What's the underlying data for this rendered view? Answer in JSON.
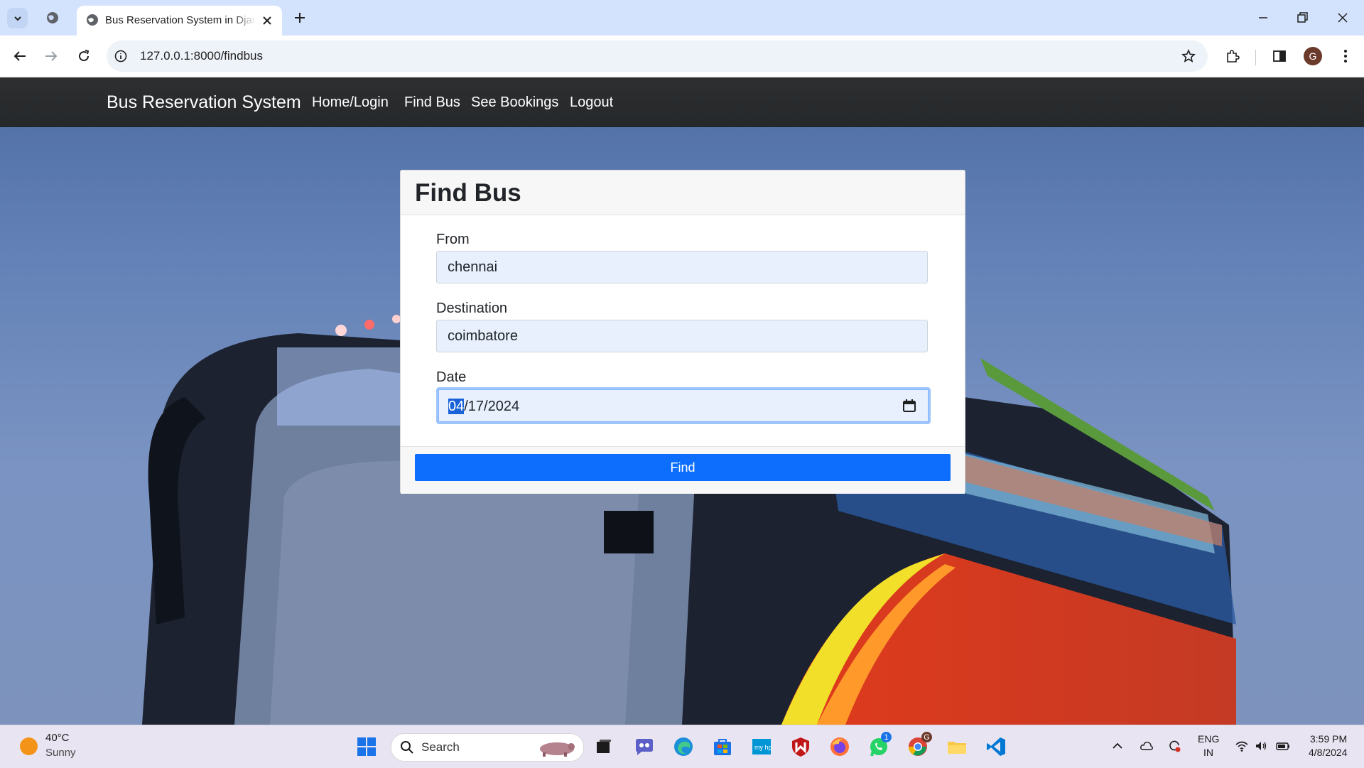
{
  "browser": {
    "tab_title": "Bus Reservation System in Django",
    "url": "127.0.0.1:8000/findbus",
    "profile_initial": "G"
  },
  "navbar": {
    "brand": "Bus Reservation System",
    "links": [
      "Home/Login",
      "Find Bus",
      "See Bookings",
      "Logout"
    ]
  },
  "form": {
    "title": "Find Bus",
    "from_label": "From",
    "from_value": "chennai",
    "destination_label": "Destination",
    "destination_value": "coimbatore",
    "date_label": "Date",
    "date_month": "04",
    "date_rest": "/17/2024",
    "submit_label": "Find"
  },
  "taskbar": {
    "weather_temp": "40°C",
    "weather_condition": "Sunny",
    "search_label": "Search",
    "language_top": "ENG",
    "language_bottom": "IN",
    "time": "3:59 PM",
    "date": "4/8/2024",
    "whatsapp_badge": "1",
    "chrome_badge": "G"
  },
  "colors": {
    "primary_button": "#0d6efd",
    "navbar_bg": "#25282a",
    "input_bg": "#e8f0fe"
  }
}
